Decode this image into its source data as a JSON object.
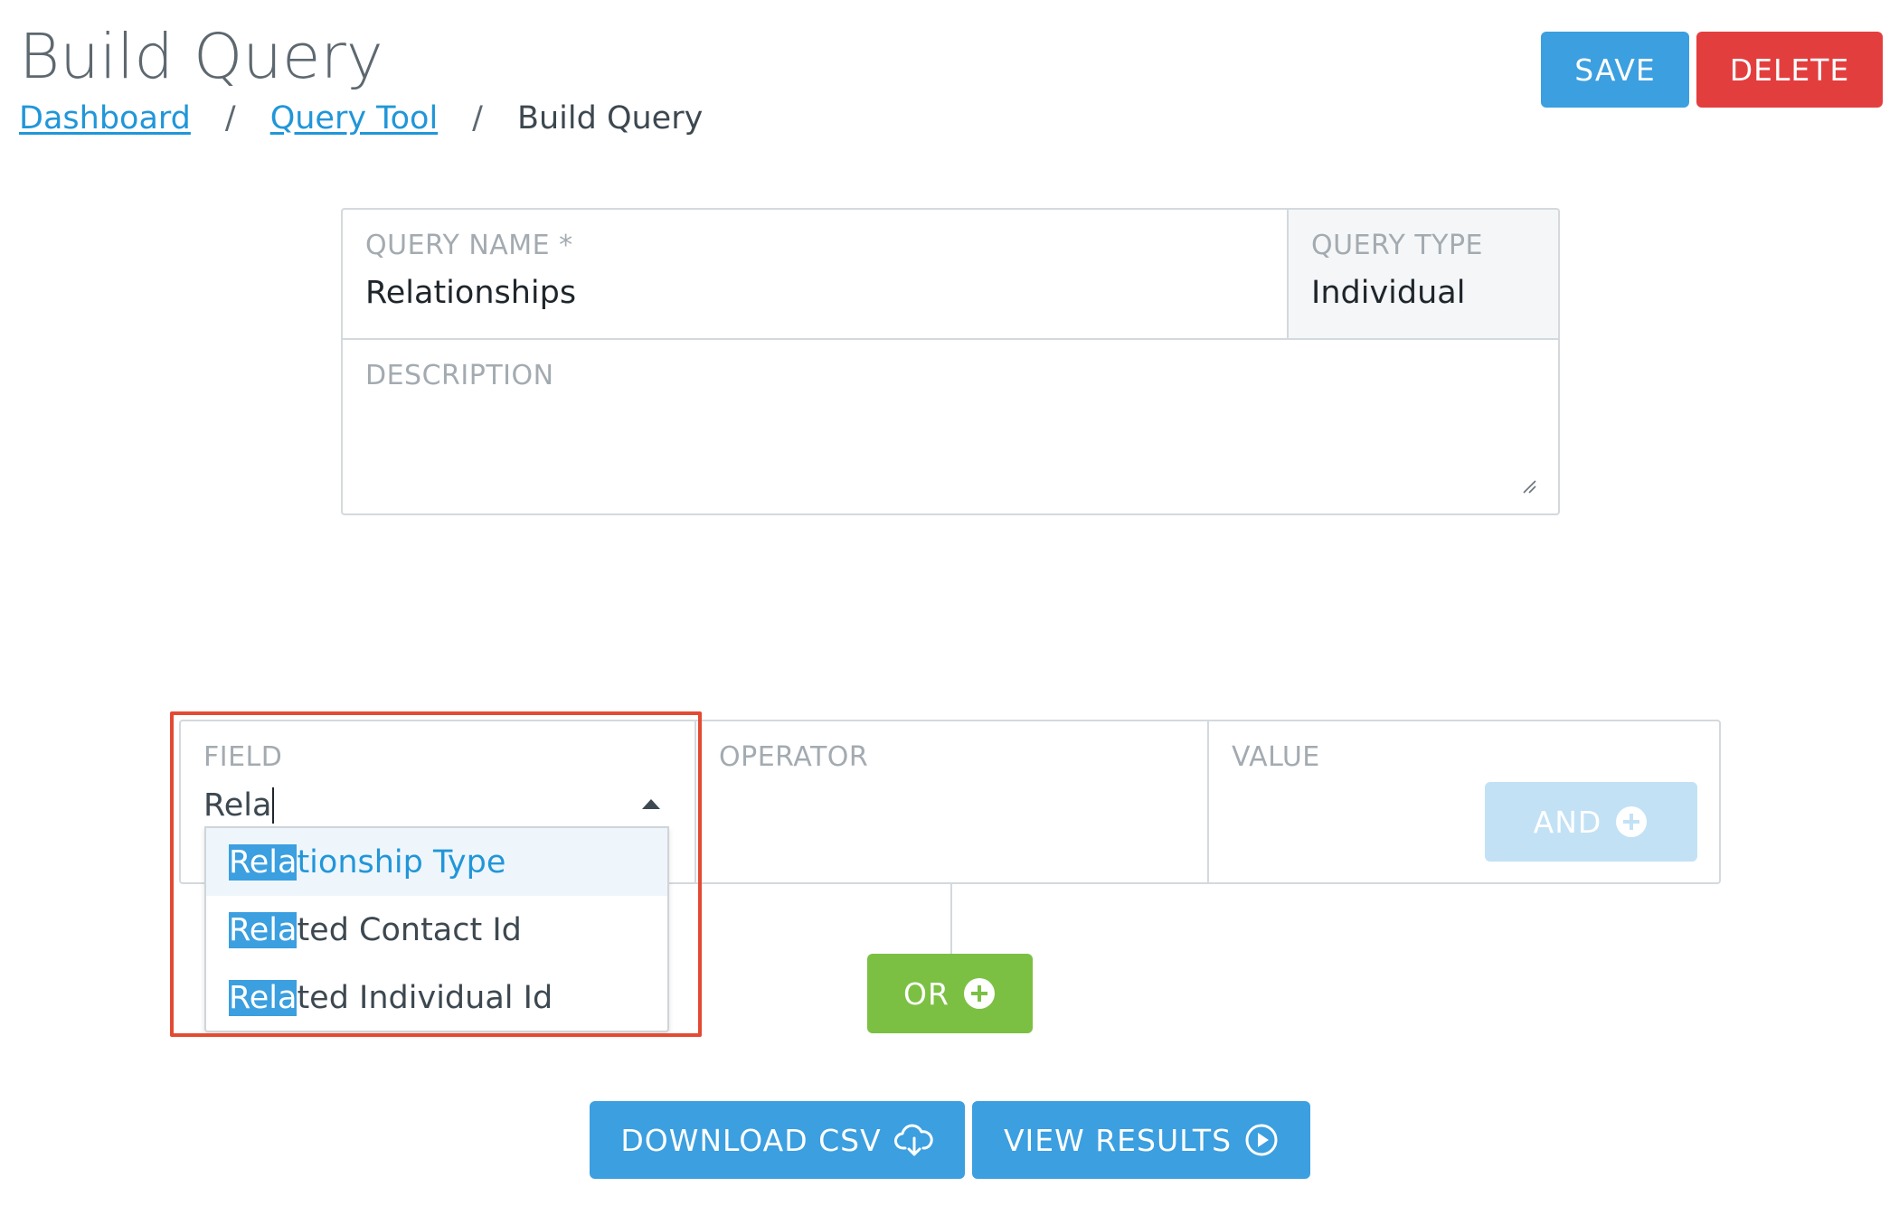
{
  "header": {
    "title": "Build Query",
    "breadcrumb": {
      "items": [
        "Dashboard",
        "Query Tool"
      ],
      "separator": "/",
      "current": "Build Query"
    },
    "save_label": "SAVE",
    "delete_label": "DELETE"
  },
  "query": {
    "name_label": "QUERY NAME *",
    "name_value": "Relationships",
    "type_label": "QUERY TYPE",
    "type_value": "Individual",
    "description_label": "DESCRIPTION",
    "description_value": ""
  },
  "condition": {
    "field_label": "FIELD",
    "field_input": "Rela",
    "operator_label": "OPERATOR",
    "value_label": "VALUE",
    "and_label": "AND",
    "or_label": "OR",
    "options": [
      {
        "match": "Rela",
        "rest": "tionship Type"
      },
      {
        "match": "Rela",
        "rest": "ted Contact Id"
      },
      {
        "match": "Rela",
        "rest": "ted Individual Id"
      }
    ]
  },
  "footer": {
    "download_label": "DOWNLOAD CSV",
    "view_label": "VIEW RESULTS"
  },
  "colors": {
    "primary": "#3b9fe0",
    "danger": "#e33e3e",
    "success": "#7bc043",
    "highlight_border": "#e34a33"
  },
  "icons": {
    "and": "circle-plus-icon",
    "or": "circle-plus-icon",
    "download": "cloud-download-icon",
    "view": "play-circle-icon"
  }
}
